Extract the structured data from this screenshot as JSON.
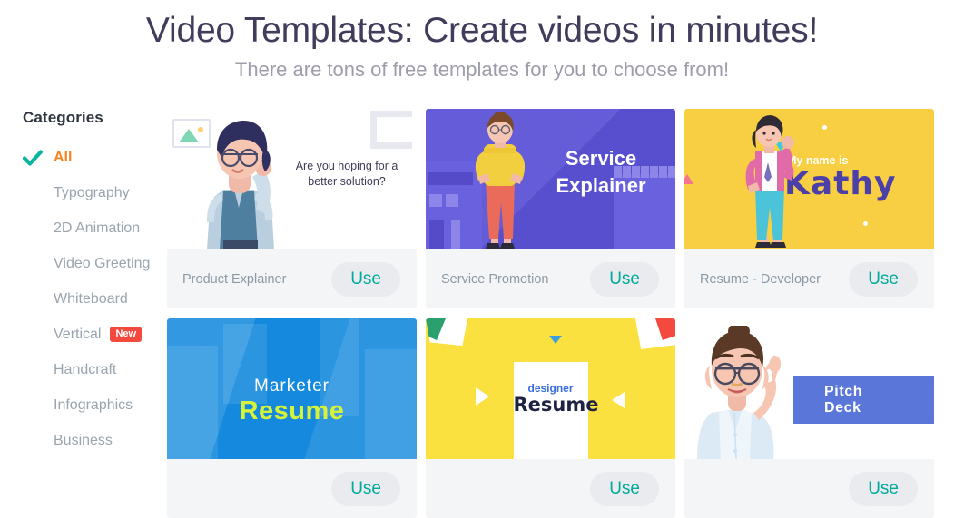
{
  "header": {
    "title": "Video Templates: Create videos in minutes!",
    "subtitle": "There are tons of free templates for you to choose from!",
    "title_color": "#413c5c",
    "subtitle_color": "#9d9dab"
  },
  "sidebar": {
    "heading": "Categories",
    "active_color": "#f5821f",
    "check_color": "#0bb3a2",
    "items": [
      {
        "label": "All",
        "active": true,
        "badge": null
      },
      {
        "label": "Typography",
        "active": false,
        "badge": null
      },
      {
        "label": "2D Animation",
        "active": false,
        "badge": null
      },
      {
        "label": "Video Greeting",
        "active": false,
        "badge": null
      },
      {
        "label": "Whiteboard",
        "active": false,
        "badge": null
      },
      {
        "label": "Vertical",
        "active": false,
        "badge": "New"
      },
      {
        "label": "Handcraft",
        "active": false,
        "badge": null
      },
      {
        "label": "Infographics",
        "active": false,
        "badge": null
      },
      {
        "label": "Business",
        "active": false,
        "badge": null
      }
    ]
  },
  "cards": [
    {
      "name": "Product Explainer",
      "use_label": "Use",
      "thumb_kind": "product-explainer",
      "thumb_text": "Are you hoping for a better solution?",
      "thumb_bg": "#ffffff"
    },
    {
      "name": "Service Promotion",
      "use_label": "Use",
      "thumb_kind": "service-explainer",
      "thumb_title_line1": "Service",
      "thumb_title_line2": "Explainer",
      "thumb_bg": "#5b52d6"
    },
    {
      "name": "Resume - Developer",
      "use_label": "Use",
      "thumb_kind": "kathy-resume",
      "thumb_intro": "My name is",
      "thumb_name": "Kathy",
      "thumb_bg": "#f8cf43"
    },
    {
      "name": "",
      "use_label": "Use",
      "thumb_kind": "marketer-resume",
      "thumb_sub": "Marketer",
      "thumb_main": "Resume",
      "thumb_bg": "#1489dd"
    },
    {
      "name": "",
      "use_label": "Use",
      "thumb_kind": "designer-resume",
      "thumb_sub": "designer",
      "thumb_main": "Resume",
      "thumb_bg": "#fbe13f"
    },
    {
      "name": "",
      "use_label": "Use",
      "thumb_kind": "pitch-deck",
      "thumb_main": "Pitch Deck",
      "thumb_bg": "#ffffff"
    }
  ],
  "icons": {
    "check": "check-icon",
    "picture_frame": "picture-frame-icon",
    "bracket": "bracket-decoration-icon"
  }
}
